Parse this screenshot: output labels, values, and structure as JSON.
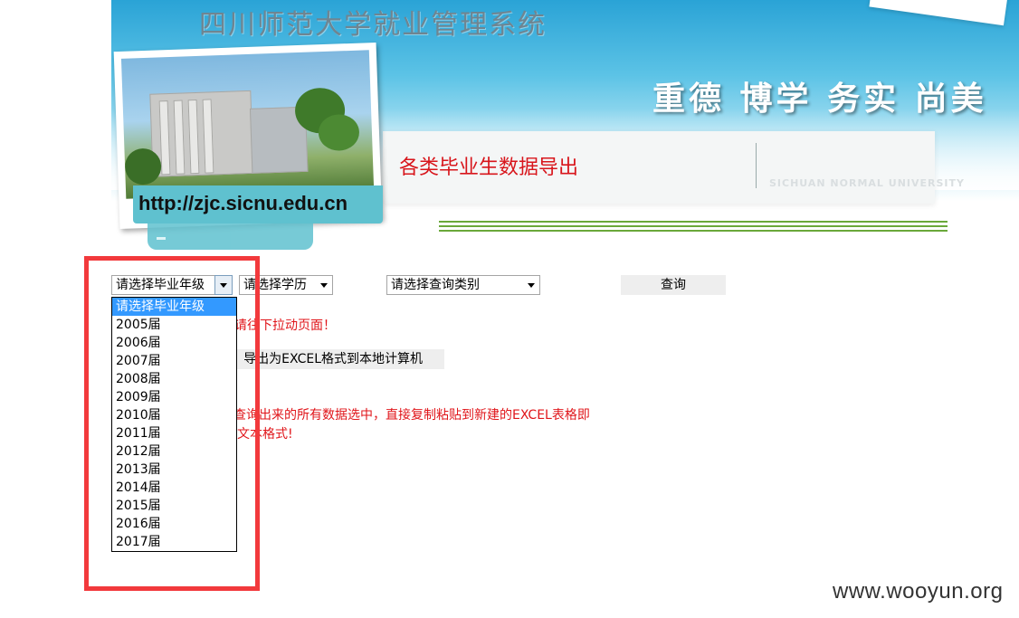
{
  "banner": {
    "system_title": "四川师范大学就业管理系统",
    "motto": "重德 博学 务实 尚美",
    "subtitle": "各类毕业生数据导出",
    "university_en": "SICHUAN NORMAL UNIVERSITY",
    "url": "http://zjc.sicnu.edu.cn"
  },
  "form": {
    "year_select": {
      "value": "请选择毕业年级"
    },
    "degree_select": {
      "value": "请选择学历"
    },
    "type_select": {
      "value": "请选择查询类别"
    },
    "query_button": "查询",
    "export_button": "导出为EXCEL格式到本地计算机"
  },
  "messages": {
    "scroll_hint": "，请往下拉动页面！",
    "copy_hint_line1": "查询出来的所有数据选中，直接复制粘贴到新建的EXCEL表格即",
    "copy_hint_line2": "文本格式!"
  },
  "dropdown": {
    "options": [
      "请选择毕业年级",
      "2005届",
      "2006届",
      "2007届",
      "2008届",
      "2009届",
      "2010届",
      "2011届",
      "2012届",
      "2013届",
      "2014届",
      "2015届",
      "2016届",
      "2017届"
    ],
    "selected_index": 0
  },
  "watermark": "www.wooyun.org",
  "colors": {
    "alert_red": "#e0151a",
    "highlight_box": "#f2393c",
    "selected_option": "#3399ff"
  }
}
